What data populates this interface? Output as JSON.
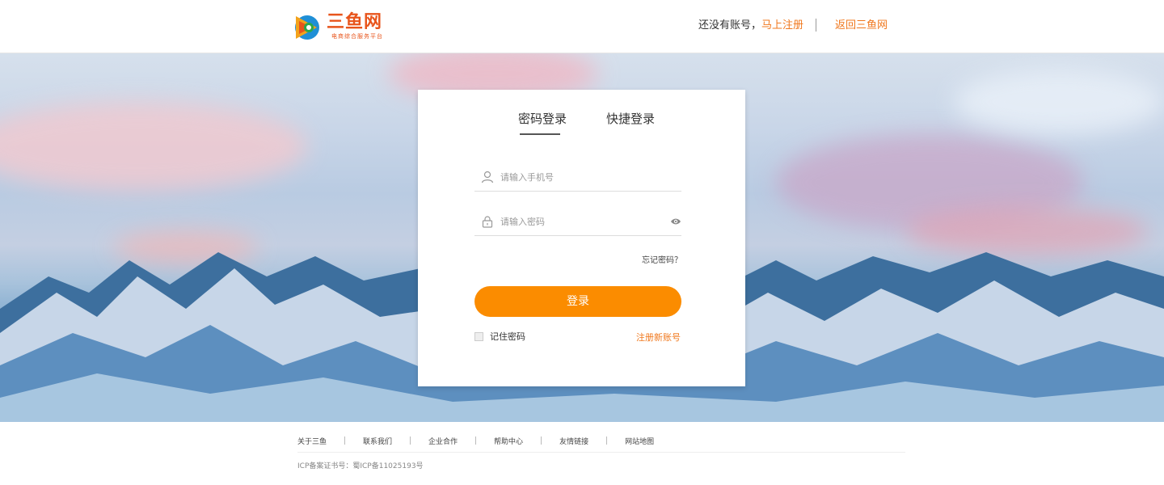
{
  "header": {
    "logo_name": "三鱼网",
    "logo_slogan": "电商综合服务平台",
    "no_account_text": "还没有账号，",
    "register_now": "马上注册",
    "back_home": "返回三鱼网"
  },
  "login": {
    "tabs": [
      {
        "label": "密码登录",
        "active": true
      },
      {
        "label": "快捷登录",
        "active": false
      }
    ],
    "phone_placeholder": "请输入手机号",
    "password_placeholder": "请输入密码",
    "forgot_password": "忘记密码？",
    "login_button": "登录",
    "remember_password": "记住密码",
    "register_new": "注册新账号"
  },
  "footer": {
    "links": [
      "关于三鱼",
      "联系我们",
      "企业合作",
      "帮助中心",
      "友情链接",
      "网站地图"
    ],
    "icp": "ICP备案证书号：蜀ICP备11025193号"
  },
  "colors": {
    "accent": "#fb8c00",
    "link_orange": "#f0781e"
  },
  "icons": [
    "fish-logo-icon",
    "user-icon",
    "lock-icon",
    "eye-icon"
  ]
}
